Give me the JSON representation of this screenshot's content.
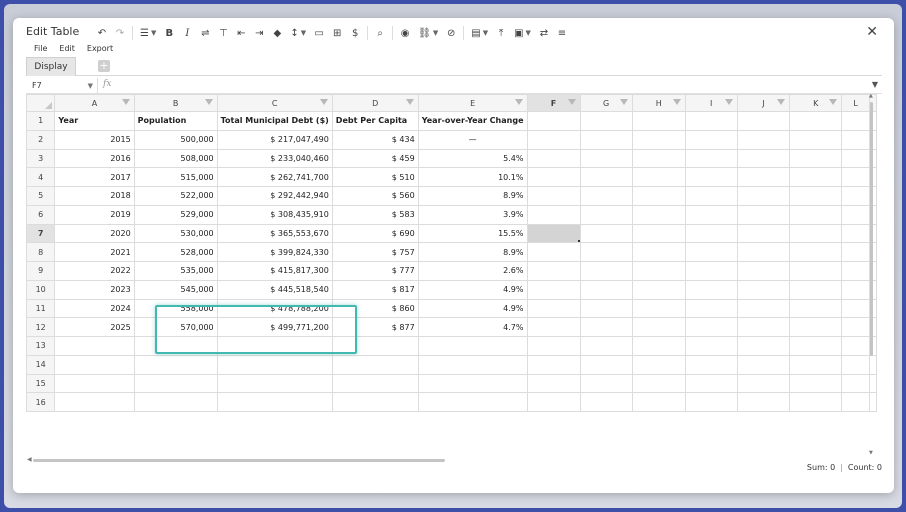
{
  "dialog": {
    "title": "Edit Table",
    "close_label": "✕"
  },
  "menu": [
    "File",
    "Edit",
    "Export"
  ],
  "toolbar": {
    "undo": "↶",
    "redo": "↷",
    "align": "☰",
    "bold": "B",
    "italic": "I",
    "wrap": "⇌",
    "text_top": "⊤",
    "indent_dec": "⇤",
    "indent_inc": "⇥",
    "fill": "◆",
    "valign": "↕",
    "merge": "▭",
    "borders": "⊞",
    "currency": "$",
    "search": "⌕",
    "view": "◉",
    "link": "⛓",
    "unlink": "⊘",
    "table_menu": "▤",
    "upload": "⤒",
    "image": "▣",
    "swap": "⇄",
    "list": "≡"
  },
  "tabs": {
    "display_label": "Display",
    "add_label": "+"
  },
  "formula": {
    "cell_ref": "F7",
    "fx": "fx",
    "value": ""
  },
  "grid": {
    "columns": [
      "A",
      "B",
      "C",
      "D",
      "E",
      "F",
      "G",
      "H",
      "I",
      "J",
      "K",
      "L"
    ],
    "selected_column": "F",
    "selected_row": 7,
    "rows": [
      [
        "1",
        "Year",
        "Population",
        "Total Municipal Debt ($)",
        "Debt Per Capita",
        "Year-over-Year Change"
      ],
      [
        "2",
        "2015",
        "500,000",
        "$ 217,047,490",
        "$ 434",
        "—"
      ],
      [
        "3",
        "2016",
        "508,000",
        "$ 233,040,460",
        "$ 459",
        "5.4%"
      ],
      [
        "4",
        "2017",
        "515,000",
        "$ 262,741,700",
        "$ 510",
        "10.1%"
      ],
      [
        "5",
        "2018",
        "522,000",
        "$ 292,442,940",
        "$ 560",
        "8.9%"
      ],
      [
        "6",
        "2019",
        "529,000",
        "$ 308,435,910",
        "$ 583",
        "3.9%"
      ],
      [
        "7",
        "2020",
        "530,000",
        "$ 365,553,670",
        "$ 690",
        "15.5%"
      ],
      [
        "8",
        "2021",
        "528,000",
        "$ 399,824,330",
        "$ 757",
        "8.9%"
      ],
      [
        "9",
        "2022",
        "535,000",
        "$ 415,817,300",
        "$ 777",
        "2.6%"
      ],
      [
        "10",
        "2023",
        "545,000",
        "$ 445,518,540",
        "$ 817",
        "4.9%"
      ],
      [
        "11",
        "2024",
        "558,000",
        "$ 478,788,200",
        "$ 860",
        "4.9%"
      ],
      [
        "12",
        "2025",
        "570,000",
        "$ 499,771,200",
        "$ 877",
        "4.7%"
      ],
      [
        "13",
        "",
        "",
        "",
        "",
        ""
      ],
      [
        "14",
        "",
        "",
        "",
        "",
        ""
      ],
      [
        "15",
        "",
        "",
        "",
        "",
        ""
      ],
      [
        "16",
        "",
        "",
        "",
        "",
        ""
      ]
    ]
  },
  "status": {
    "sum": "Sum: 0",
    "count": "Count: 0"
  }
}
